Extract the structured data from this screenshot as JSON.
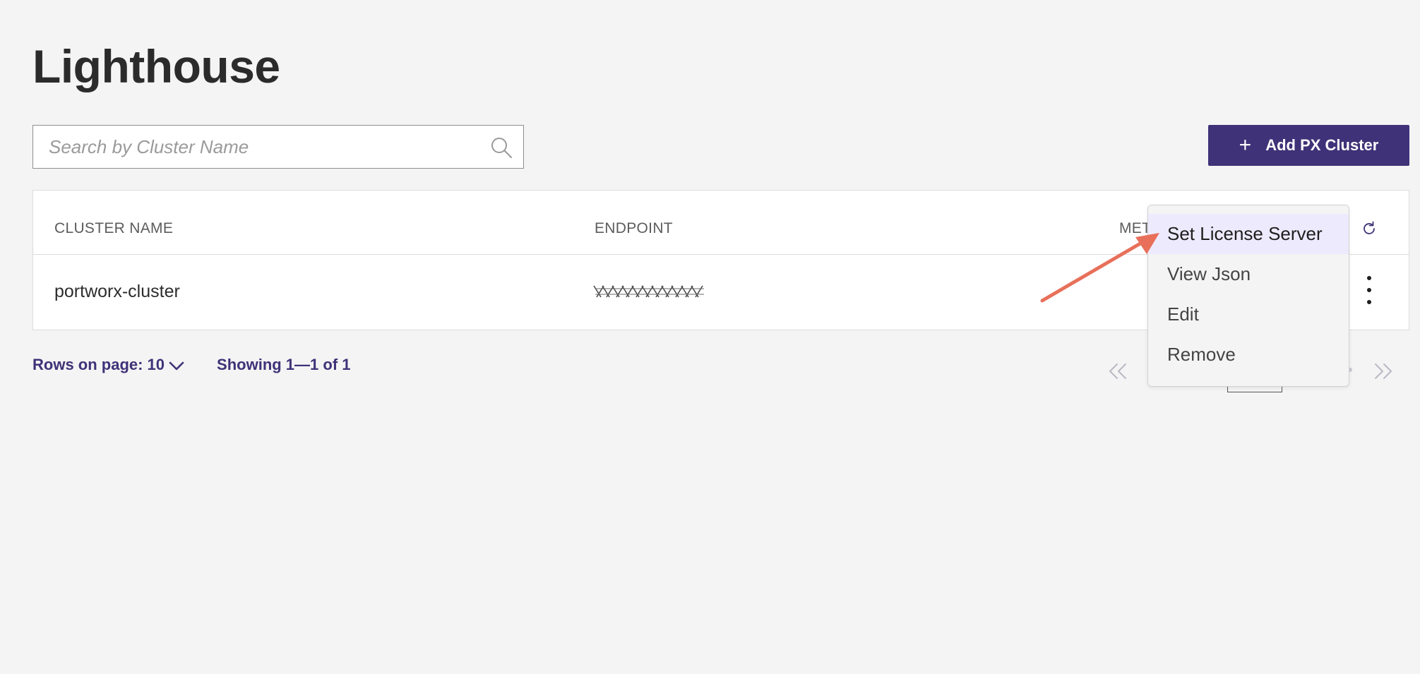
{
  "page": {
    "title": "Lighthouse"
  },
  "search": {
    "placeholder": "Search by Cluster Name",
    "value": ""
  },
  "toolbar": {
    "add_label": "Add PX Cluster",
    "add_icon": "plus-icon"
  },
  "table": {
    "columns": [
      "CLUSTER NAME",
      "ENDPOINT",
      "MET"
    ],
    "refresh_icon": "refresh-icon",
    "rows": [
      {
        "cluster_name": "portworx-cluster",
        "endpoint": "redacted",
        "actions_icon": "kebab-menu-icon"
      }
    ]
  },
  "pagination": {
    "rows_label": "Rows on page: 10",
    "showing_label": "Showing 1—1 of 1"
  },
  "context_menu": {
    "items": [
      "Set License Server",
      "View Json",
      "Edit",
      "Remove"
    ],
    "highlighted": "Set License Server"
  },
  "colors": {
    "brand": "#3f3278",
    "background": "#f4f4f4",
    "menu_highlight": "#eeeafd",
    "annotation_arrow": "#e8705a"
  }
}
